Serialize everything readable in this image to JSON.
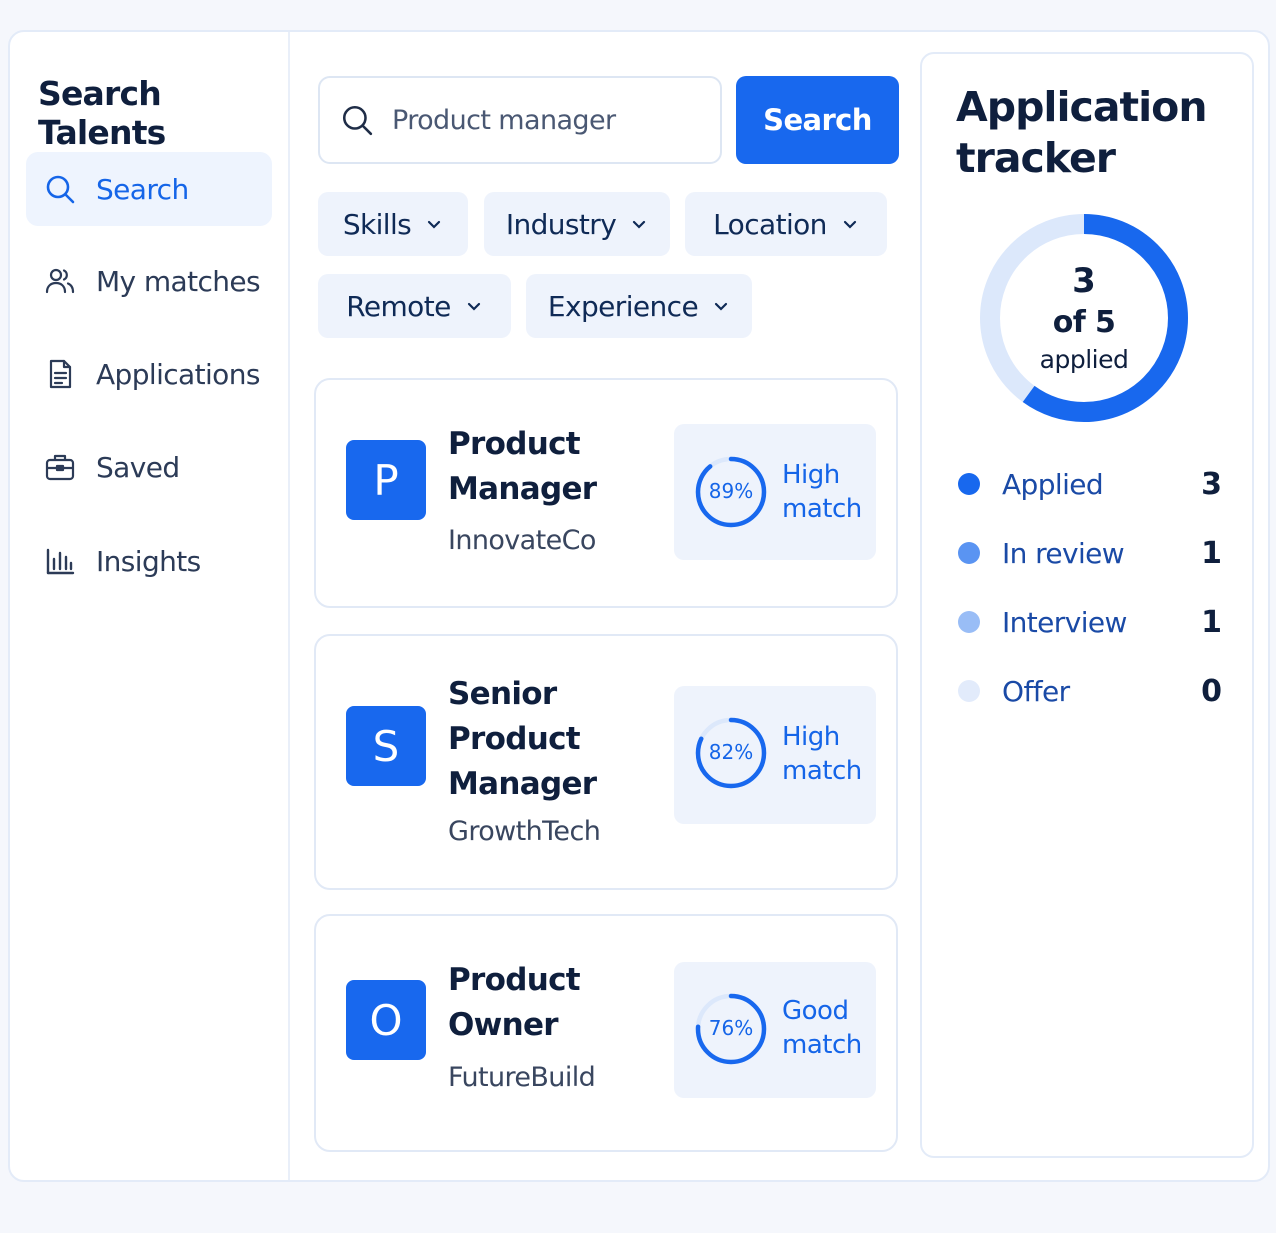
{
  "sidebar": {
    "brand": "Search Talents",
    "items": [
      {
        "label": "Search",
        "icon": "search-icon",
        "active": true
      },
      {
        "label": "My matches",
        "icon": "users-icon"
      },
      {
        "label": "Applications",
        "icon": "document-icon"
      },
      {
        "label": "Saved",
        "icon": "briefcase-icon"
      },
      {
        "label": "Insights",
        "icon": "bar-chart-icon"
      }
    ]
  },
  "search": {
    "placeholder": "Product manager",
    "button_label": "Search"
  },
  "filters": [
    "Skills",
    "Industry",
    "Location",
    "Remote",
    "Experience"
  ],
  "jobs": [
    {
      "initial": "P",
      "title": "Product Manager",
      "company": "InnovateCo",
      "match_percent": 89,
      "match_label": "89%",
      "match_text": "High match"
    },
    {
      "initial": "S",
      "title": "Senior Product Manager",
      "company": "GrowthTech",
      "match_percent": 82,
      "match_label": "82%",
      "match_text": "High match"
    },
    {
      "initial": "O",
      "title": "Product Owner",
      "company": "FutureBuild",
      "match_percent": 76,
      "match_label": "76%",
      "match_text": "Good match"
    }
  ],
  "tracker": {
    "title": "Application tracker",
    "applied": "3",
    "of_total": "of 5",
    "sub_label": "applied",
    "progress": 0.6,
    "legend": [
      {
        "label": "Applied",
        "count": "3",
        "color": "#1868ee"
      },
      {
        "label": "In review",
        "count": "1",
        "color": "#5a94f2"
      },
      {
        "label": "Interview",
        "count": "1",
        "color": "#99bdf6"
      },
      {
        "label": "Offer",
        "count": "0",
        "color": "#e2ebfb"
      }
    ]
  },
  "colors": {
    "accent": "#1868ee",
    "accent_light": "#eef3fc",
    "ring_track": "#dce8fb"
  }
}
